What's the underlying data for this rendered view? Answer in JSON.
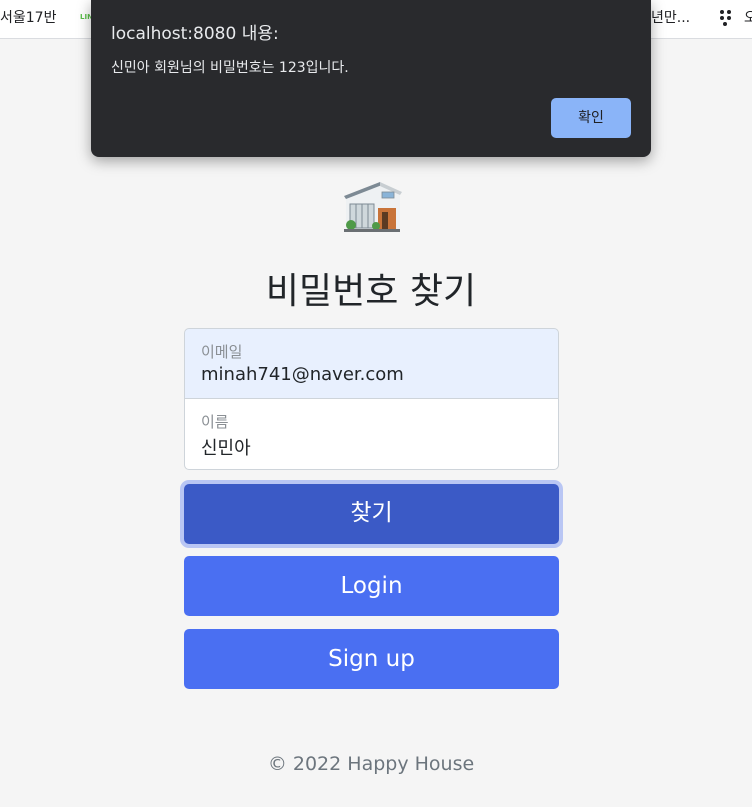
{
  "bookmarks": {
    "left_item": "서울17반",
    "tiny_item": "LIN",
    "right_item": "년만...",
    "edge_item": "오"
  },
  "dialog": {
    "title": "localhost:8080 내용:",
    "message": "신민아 회원님의 비밀번호는 123입니다.",
    "ok_label": "확인"
  },
  "page": {
    "title": "비밀번호 찾기"
  },
  "form": {
    "email_label": "이메일",
    "email_value": "minah741@naver.com",
    "name_label": "이름",
    "name_value": "신민아"
  },
  "buttons": {
    "find": "찾기",
    "login": "Login",
    "signup": "Sign up"
  },
  "footer": {
    "text": "© 2022 Happy House"
  },
  "colors": {
    "dialog_bg": "#292a2d",
    "dialog_button": "#8ab4f8",
    "primary_button": "#4a6ff2",
    "active_button": "#3b5ac6",
    "autofill_bg": "#e8f0fe"
  }
}
